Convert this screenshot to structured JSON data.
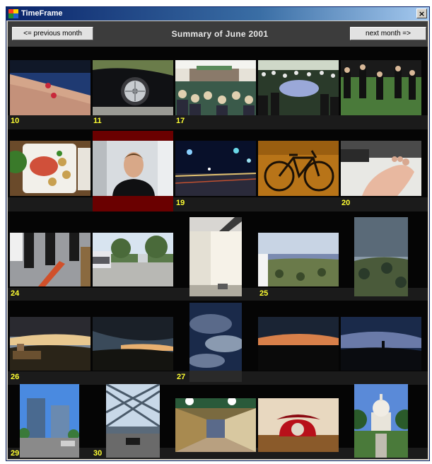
{
  "window": {
    "title": "TimeFrame",
    "close_glyph": "×"
  },
  "nav": {
    "prev_label": "<= previous month",
    "title": "Summary of June 2001",
    "next_label": "next month =>"
  },
  "colors": {
    "day_label": "#ffff33",
    "selected_cell": "#6a0000",
    "background": "#050505"
  },
  "rows": [
    {
      "labels": [
        {
          "text": "10",
          "col": 0
        },
        {
          "text": "11",
          "col": 1
        },
        {
          "text": "17",
          "col": 2
        }
      ]
    },
    {
      "labels": [
        {
          "text": "19",
          "col": 2
        },
        {
          "text": "20",
          "col": 4
        }
      ]
    },
    {
      "labels": [
        {
          "text": "24",
          "col": 0
        },
        {
          "text": "25",
          "col": 3
        }
      ]
    },
    {
      "labels": [
        {
          "text": "26",
          "col": 0
        },
        {
          "text": "27",
          "col": 2
        }
      ]
    },
    {
      "labels": [
        {
          "text": "29",
          "col": 0
        },
        {
          "text": "30",
          "col": 1
        }
      ]
    }
  ],
  "photos": [
    {
      "icon": "arm-wound-photo"
    },
    {
      "icon": "car-wheel-photo"
    },
    {
      "icon": "graduation-stage-photo"
    },
    {
      "icon": "graduation-crowd-photo"
    },
    {
      "icon": "graduates-lawn-photo"
    },
    {
      "icon": "food-plate-photo"
    },
    {
      "icon": "man-portrait-photo"
    },
    {
      "icon": "night-street-photo"
    },
    {
      "icon": "bicycle-photo"
    },
    {
      "icon": "bare-foot-photo"
    },
    {
      "icon": "legs-scissors-photo"
    },
    {
      "icon": "parking-lot-photo"
    },
    {
      "icon": "room-corner-photo"
    },
    {
      "icon": "valley-view-photo"
    },
    {
      "icon": "hillside-view-photo"
    },
    {
      "icon": "sunset-hills-photo"
    },
    {
      "icon": "dusk-ridge-photo"
    },
    {
      "icon": "cloudy-sky-photo"
    },
    {
      "icon": "sunset-horizon-photo"
    },
    {
      "icon": "dark-clouds-photo"
    },
    {
      "icon": "office-towers-photo"
    },
    {
      "icon": "steel-bridge-photo"
    },
    {
      "icon": "hallway-photo"
    },
    {
      "icon": "red-telephone-photo"
    },
    {
      "icon": "capitol-dome-photo"
    }
  ]
}
